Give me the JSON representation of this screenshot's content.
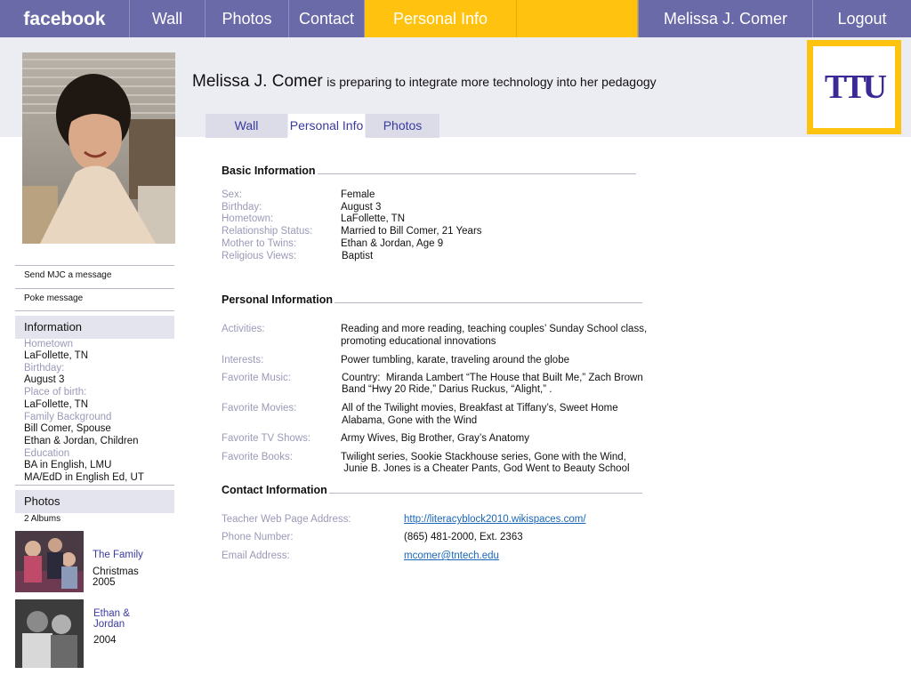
{
  "nav": {
    "brand": "facebook",
    "wall": "Wall",
    "photos": "Photos",
    "contact": "Contact",
    "personal_info": "Personal Info",
    "user_name": "Melissa J. Comer",
    "logout": "Logout"
  },
  "colors": {
    "nav_bg": "#6a6aa8",
    "nav_active": "#ffc20e",
    "band_bg": "#ececf3",
    "label": "#9a9ab8",
    "logo_purple": "#3a2a96"
  },
  "header": {
    "name": "Melissa J. Comer",
    "status": "is preparing to integrate more technology into her pedagogy",
    "logo_text": "TTU"
  },
  "tabs": {
    "wall": "Wall",
    "personal_info": "Personal Info",
    "photos": "Photos"
  },
  "sidebar": {
    "send_message": "Send MJC a message",
    "poke": "Poke message",
    "info_header": "Information",
    "info": [
      {
        "label": "Hometown",
        "value": "LaFollette, TN"
      },
      {
        "label": "Birthday:",
        "value": "August 3"
      },
      {
        "label": "Place of birth:",
        "value": "LaFollette, TN"
      },
      {
        "label": "Family Background",
        "value": "Bill Comer, Spouse",
        "value2": "Ethan & Jordan, Children"
      },
      {
        "label": "Education",
        "value": "BA in English, LMU",
        "value2": "MA/EdD in English Ed, UT"
      }
    ],
    "photos_header": "Photos",
    "albums_count": "2 Albums",
    "albums": [
      {
        "title": "The Family",
        "sub1": "Christmas",
        "sub2": "2005"
      },
      {
        "title1": "Ethan &",
        "title2": "Jordan",
        "sub1": "2004"
      }
    ]
  },
  "basic": {
    "title": "Basic Information",
    "rows": [
      {
        "label": "Sex:",
        "value": "Female"
      },
      {
        "label": "Birthday:",
        "value": "August 3"
      },
      {
        "label": "Hometown:",
        "value": "LaFollette, TN"
      },
      {
        "label": "Relationship Status:",
        "value": "Married to Bill Comer, 21 Years"
      },
      {
        "label": "Mother to Twins:",
        "value": "Ethan & Jordan, Age 9"
      },
      {
        "label": "Religious Views:",
        "value": "Baptist"
      }
    ]
  },
  "personal": {
    "title": "Personal Information",
    "activities_label": "Activities:",
    "activities_1": "Reading and more reading, teaching couples’ Sunday School class,",
    "activities_2": "promoting educational innovations",
    "interests_label": "Interests:",
    "interests": "Power tumbling, karate, traveling around the globe",
    "music_label": "Favorite Music:",
    "music_1": "Country:  Miranda Lambert “The House that Built Me,” Zach Brown",
    "music_2": "Band “Hwy 20 Ride,” Darius Ruckus, “Alight,” .",
    "movies_label": "Favorite Movies:",
    "movies_1": "All of the Twilight movies, Breakfast at Tiffany’s, Sweet Home",
    "movies_2": "Alabama, Gone with the Wind",
    "tv_label": "Favorite TV Shows:",
    "tv": "Army Wives, Big Brother, Gray’s Anatomy",
    "books_label": "Favorite Books:",
    "books_1": "Twilight series, Sookie Stackhouse series, Gone with the Wind,",
    "books_2": " Junie B. Jones is a Cheater Pants, God Went to Beauty School"
  },
  "contact": {
    "title": "Contact Information",
    "web_label": "Teacher Web Page Address:",
    "web": "http://literacyblock2010.wikispaces.com/",
    "phone_label": "Phone Number:",
    "phone": "(865) 481-2000, Ext. 2363",
    "email_label": "Email Address:",
    "email": "mcomer@tntech.edu"
  }
}
